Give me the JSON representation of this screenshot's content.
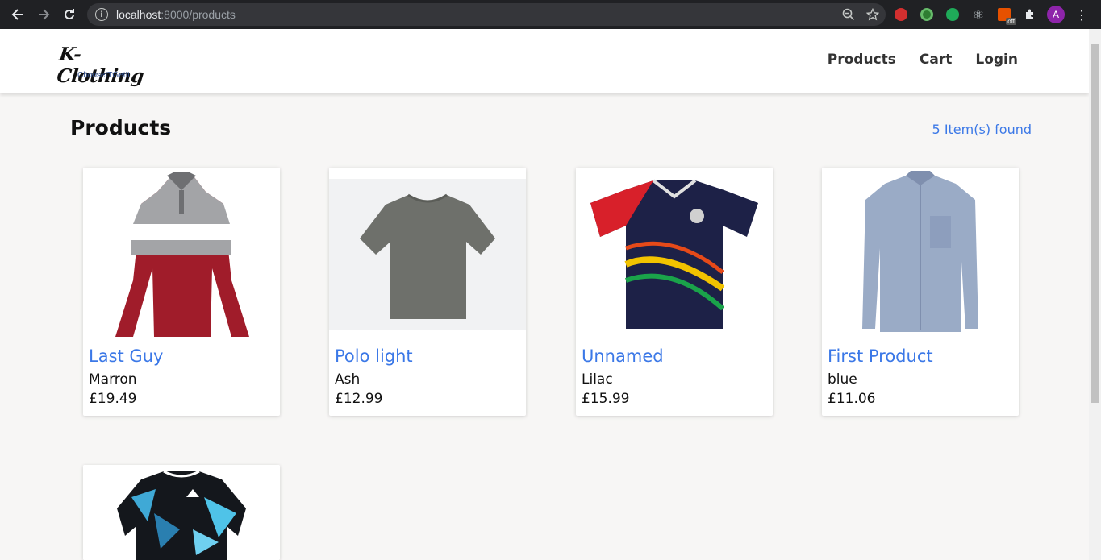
{
  "browser": {
    "url_host": "localhost",
    "url_rest": ":8000/products",
    "profile_initial": "A",
    "ext_off_label": "off"
  },
  "site": {
    "brand": "K-Clothing",
    "tagline": "ChooseITGetIt",
    "nav": [
      "Products",
      "Cart",
      "Login"
    ]
  },
  "main": {
    "title": "Products",
    "count": "5 Item(s) found"
  },
  "products": [
    {
      "name": "Last Guy",
      "color": "Marron",
      "price": "£19.49"
    },
    {
      "name": "Polo light",
      "color": "Ash",
      "price": "£12.99"
    },
    {
      "name": "Unnamed",
      "color": "Lilac",
      "price": "£15.99"
    },
    {
      "name": "First Product",
      "color": "blue",
      "price": "£11.06"
    },
    {
      "name": "",
      "color": "",
      "price": ""
    }
  ]
}
